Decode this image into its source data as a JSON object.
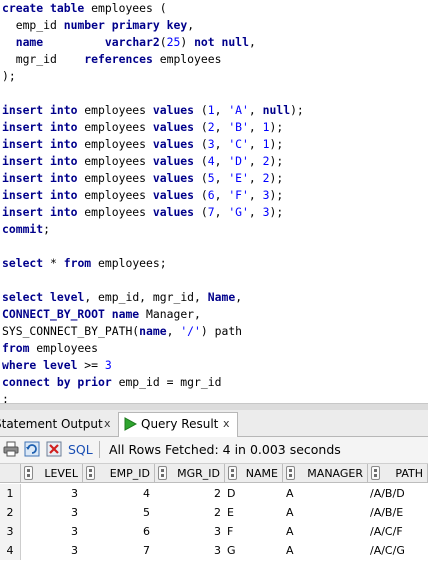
{
  "editor": {
    "lines": [
      [
        [
          "create table",
          "kw"
        ],
        [
          " employees (",
          ""
        ]
      ],
      [
        [
          "  emp_id ",
          ""
        ],
        [
          "number",
          "kw"
        ],
        [
          " ",
          ""
        ],
        [
          "primary key",
          "kw"
        ],
        [
          ",",
          ""
        ]
      ],
      [
        [
          "  ",
          ""
        ],
        [
          "name",
          "kw"
        ],
        [
          "         ",
          ""
        ],
        [
          "varchar2",
          "kw"
        ],
        [
          "(",
          ""
        ],
        [
          "25",
          "num"
        ],
        [
          ") ",
          ""
        ],
        [
          "not null",
          "kw"
        ],
        [
          ",",
          ""
        ]
      ],
      [
        [
          "  mgr_id    ",
          ""
        ],
        [
          "references",
          "kw"
        ],
        [
          " employees",
          ""
        ]
      ],
      [
        [
          ");",
          ""
        ]
      ],
      [
        [
          "",
          ""
        ]
      ],
      [
        [
          "insert into",
          "kw"
        ],
        [
          " employees ",
          ""
        ],
        [
          "values",
          "kw"
        ],
        [
          " (",
          ""
        ],
        [
          "1",
          "num"
        ],
        [
          ", ",
          ""
        ],
        [
          "'A'",
          "str"
        ],
        [
          ", ",
          ""
        ],
        [
          "null",
          "kw"
        ],
        [
          ");",
          ""
        ]
      ],
      [
        [
          "insert into",
          "kw"
        ],
        [
          " employees ",
          ""
        ],
        [
          "values",
          "kw"
        ],
        [
          " (",
          ""
        ],
        [
          "2",
          "num"
        ],
        [
          ", ",
          ""
        ],
        [
          "'B'",
          "str"
        ],
        [
          ", ",
          ""
        ],
        [
          "1",
          "num"
        ],
        [
          ");",
          ""
        ]
      ],
      [
        [
          "insert into",
          "kw"
        ],
        [
          " employees ",
          ""
        ],
        [
          "values",
          "kw"
        ],
        [
          " (",
          ""
        ],
        [
          "3",
          "num"
        ],
        [
          ", ",
          ""
        ],
        [
          "'C'",
          "str"
        ],
        [
          ", ",
          ""
        ],
        [
          "1",
          "num"
        ],
        [
          ");",
          ""
        ]
      ],
      [
        [
          "insert into",
          "kw"
        ],
        [
          " employees ",
          ""
        ],
        [
          "values",
          "kw"
        ],
        [
          " (",
          ""
        ],
        [
          "4",
          "num"
        ],
        [
          ", ",
          ""
        ],
        [
          "'D'",
          "str"
        ],
        [
          ", ",
          ""
        ],
        [
          "2",
          "num"
        ],
        [
          ");",
          ""
        ]
      ],
      [
        [
          "insert into",
          "kw"
        ],
        [
          " employees ",
          ""
        ],
        [
          "values",
          "kw"
        ],
        [
          " (",
          ""
        ],
        [
          "5",
          "num"
        ],
        [
          ", ",
          ""
        ],
        [
          "'E'",
          "str"
        ],
        [
          ", ",
          ""
        ],
        [
          "2",
          "num"
        ],
        [
          ");",
          ""
        ]
      ],
      [
        [
          "insert into",
          "kw"
        ],
        [
          " employees ",
          ""
        ],
        [
          "values",
          "kw"
        ],
        [
          " (",
          ""
        ],
        [
          "6",
          "num"
        ],
        [
          ", ",
          ""
        ],
        [
          "'F'",
          "str"
        ],
        [
          ", ",
          ""
        ],
        [
          "3",
          "num"
        ],
        [
          ");",
          ""
        ]
      ],
      [
        [
          "insert into",
          "kw"
        ],
        [
          " employees ",
          ""
        ],
        [
          "values",
          "kw"
        ],
        [
          " (",
          ""
        ],
        [
          "7",
          "num"
        ],
        [
          ", ",
          ""
        ],
        [
          "'G'",
          "str"
        ],
        [
          ", ",
          ""
        ],
        [
          "3",
          "num"
        ],
        [
          ");",
          ""
        ]
      ],
      [
        [
          "commit",
          "kw"
        ],
        [
          ";",
          ""
        ]
      ],
      [
        [
          "",
          ""
        ]
      ],
      [
        [
          "select",
          "kw"
        ],
        [
          " * ",
          ""
        ],
        [
          "from",
          "kw"
        ],
        [
          " employees;",
          ""
        ]
      ],
      [
        [
          "",
          ""
        ]
      ],
      [
        [
          "select",
          "kw"
        ],
        [
          " ",
          ""
        ],
        [
          "level",
          "kw"
        ],
        [
          ", emp_id, mgr_id, ",
          ""
        ],
        [
          "Name",
          "kw"
        ],
        [
          ",",
          ""
        ]
      ],
      [
        [
          "CONNECT_BY_ROOT",
          "kw"
        ],
        [
          " ",
          ""
        ],
        [
          "name",
          "kw"
        ],
        [
          " Manager,",
          ""
        ]
      ],
      [
        [
          "SYS_CONNECT_BY_PATH(",
          ""
        ],
        [
          "name",
          "kw"
        ],
        [
          ", ",
          ""
        ],
        [
          "'/'",
          "str"
        ],
        [
          ") path",
          ""
        ]
      ],
      [
        [
          "from",
          "kw"
        ],
        [
          " employees",
          ""
        ]
      ],
      [
        [
          "where",
          "kw"
        ],
        [
          " ",
          ""
        ],
        [
          "level",
          "kw"
        ],
        [
          " >= ",
          ""
        ],
        [
          "3",
          "num"
        ]
      ],
      [
        [
          "connect by prior",
          "kw"
        ],
        [
          " emp_id = mgr_id",
          ""
        ]
      ],
      [
        [
          ";",
          ""
        ]
      ]
    ]
  },
  "tabs": {
    "statement_output": "Statement Output",
    "query_result": "Query Result",
    "close": "x"
  },
  "toolbar": {
    "sql_label": "SQL",
    "status": "All Rows Fetched: 4 in 0.003 seconds"
  },
  "grid": {
    "columns": [
      "LEVEL",
      "EMP_ID",
      "MGR_ID",
      "NAME",
      "MANAGER",
      "PATH"
    ],
    "rows": [
      [
        "1",
        "3",
        "4",
        "2",
        "D",
        "A",
        "/A/B/D"
      ],
      [
        "2",
        "3",
        "5",
        "2",
        "E",
        "A",
        "/A/B/E"
      ],
      [
        "3",
        "3",
        "6",
        "3",
        "F",
        "A",
        "/A/C/F"
      ],
      [
        "4",
        "3",
        "7",
        "3",
        "G",
        "A",
        "/A/C/G"
      ]
    ]
  },
  "colors": {
    "keyword": "#00008b",
    "literal": "#0000ff",
    "run_icon": "#2fa52f",
    "sql_link": "#1a4fb4"
  }
}
